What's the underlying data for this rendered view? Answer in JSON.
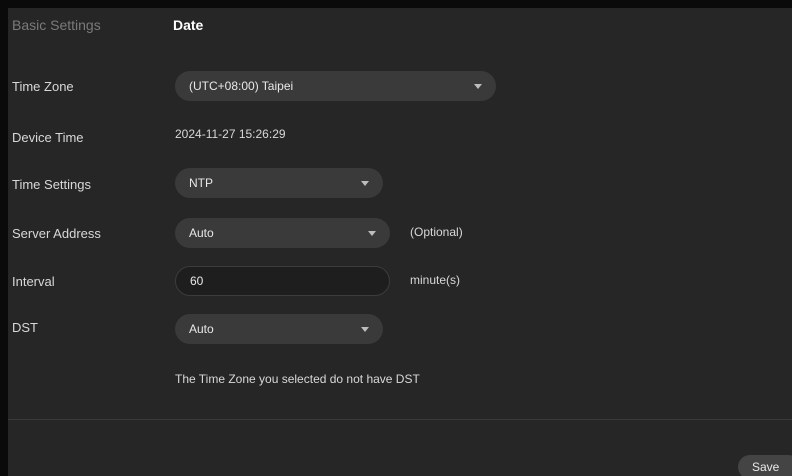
{
  "breadcrumb": {
    "section": "Basic Settings",
    "page": "Date"
  },
  "time_zone": {
    "label": "Time Zone",
    "value": "(UTC+08:00) Taipei"
  },
  "device_time": {
    "label": "Device Time",
    "value": "2024-11-27 15:26:29"
  },
  "time_settings": {
    "label": "Time Settings",
    "value": "NTP"
  },
  "server_address": {
    "label": "Server Address",
    "value": "Auto",
    "hint": "(Optional)"
  },
  "interval": {
    "label": "Interval",
    "value": "60",
    "unit": "minute(s)"
  },
  "dst": {
    "label": "DST",
    "value": "Auto",
    "note": "The Time Zone you selected do not have DST"
  },
  "footer": {
    "save_label": "Save"
  },
  "icons": {
    "dropdown": "caret-down-icon"
  },
  "colors": {
    "background": "#262626",
    "control": "#3a3a3a",
    "text": "#d8d8d8"
  }
}
